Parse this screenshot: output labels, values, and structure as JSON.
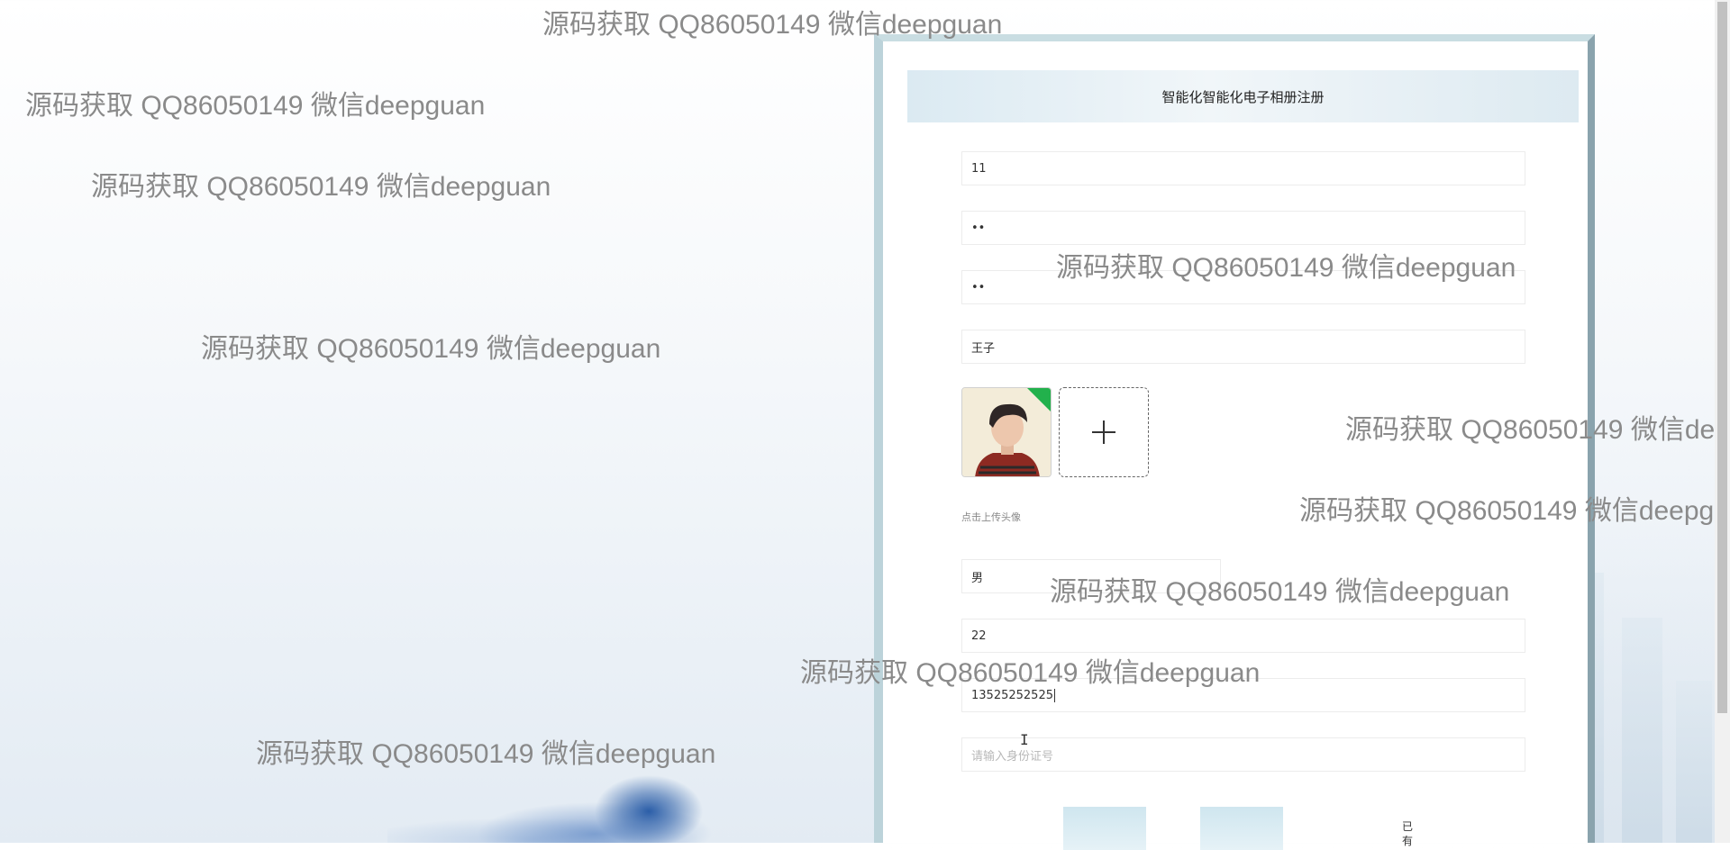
{
  "watermark_text": "源码获取 QQ86050149 微信deepguan",
  "form": {
    "title": "智能化智能化电子相册注册",
    "fields": [
      {
        "name": "account",
        "value": "11"
      },
      {
        "name": "password",
        "value": "••"
      },
      {
        "name": "confirm_password",
        "value": "••"
      },
      {
        "name": "name",
        "value": "王子"
      },
      {
        "name": "gender",
        "value": "男"
      },
      {
        "name": "age",
        "value": "22"
      },
      {
        "name": "phone",
        "value": "13525252525"
      },
      {
        "name": "id_card",
        "value": "",
        "placeholder": "请输入身份证号"
      }
    ],
    "upload_hint": "点击上传头像",
    "login_link": "已有"
  },
  "icons": {
    "upload": "plus-icon",
    "avatar_badge": "green-corner-badge"
  },
  "colors": {
    "badge": "#22b14c",
    "button": "#cfe6ef",
    "watermark": "#8a8a8a"
  }
}
